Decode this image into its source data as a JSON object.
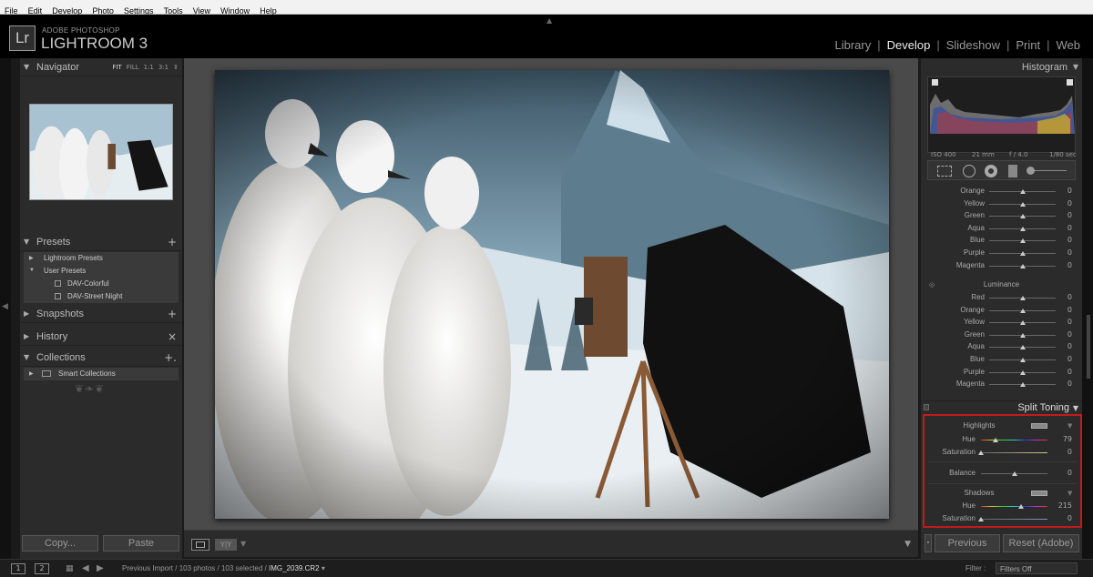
{
  "menubar": {
    "items": [
      "File",
      "Edit",
      "Develop",
      "Photo",
      "Settings",
      "Tools",
      "View",
      "Window",
      "Help"
    ]
  },
  "identity": {
    "top": "ADOBE PHOTOSHOP",
    "name": "LIGHTROOM 3",
    "logo": "Lr"
  },
  "modules": {
    "items": [
      {
        "label": "Library",
        "active": false
      },
      {
        "label": "Develop",
        "active": true
      },
      {
        "label": "Slideshow",
        "active": false
      },
      {
        "label": "Print",
        "active": false
      },
      {
        "label": "Web",
        "active": false
      }
    ]
  },
  "left_panel": {
    "navigator": {
      "title": "Navigator",
      "options": [
        "FIT",
        "FILL",
        "1:1",
        "3:1"
      ]
    },
    "presets": {
      "title": "Presets",
      "action": "+",
      "tree": [
        {
          "label": "Lightroom Presets",
          "level": 0,
          "open": false
        },
        {
          "label": "User Presets",
          "level": 0,
          "open": true
        },
        {
          "label": "DAV-Colorful",
          "level": 1
        },
        {
          "label": "DAV-Street Night",
          "level": 1
        }
      ]
    },
    "snapshots": {
      "title": "Snapshots",
      "action": "+"
    },
    "history": {
      "title": "History",
      "action": "×"
    },
    "collections": {
      "title": "Collections",
      "action": "+.",
      "smart": "Smart Collections"
    },
    "copy_label": "Copy...",
    "paste_label": "Paste"
  },
  "right_panel": {
    "histogram": {
      "title": "Histogram",
      "exif": [
        "ISO 400",
        "21 mm",
        "f / 4.0",
        "1/80 sec"
      ]
    },
    "hsl_top": [
      {
        "label": "Orange",
        "value": "0"
      },
      {
        "label": "Yellow",
        "value": "0"
      },
      {
        "label": "Green",
        "value": "0"
      },
      {
        "label": "Aqua",
        "value": "0"
      },
      {
        "label": "Blue",
        "value": "0"
      },
      {
        "label": "Purple",
        "value": "0"
      },
      {
        "label": "Magenta",
        "value": "0"
      }
    ],
    "luminance_title": "Luminance",
    "luminance": [
      {
        "label": "Red",
        "value": "0"
      },
      {
        "label": "Orange",
        "value": "0"
      },
      {
        "label": "Yellow",
        "value": "0"
      },
      {
        "label": "Green",
        "value": "0"
      },
      {
        "label": "Aqua",
        "value": "0"
      },
      {
        "label": "Blue",
        "value": "0"
      },
      {
        "label": "Purple",
        "value": "0"
      },
      {
        "label": "Magenta",
        "value": "0"
      }
    ],
    "split_toning": {
      "title": "Split Toning",
      "highlights_label": "Highlights",
      "highlights_hue_label": "Hue",
      "highlights_hue": "79",
      "highlights_hue_fraction": 0.22,
      "highlights_sat_label": "Saturation",
      "highlights_sat": "0",
      "highlights_sat_fraction": 0.0,
      "balance_label": "Balance",
      "balance": "0",
      "balance_fraction": 0.5,
      "shadows_label": "Shadows",
      "shadows_hue_label": "Hue",
      "shadows_hue": "215",
      "shadows_hue_fraction": 0.6,
      "shadows_sat_label": "Saturation",
      "shadows_sat": "0",
      "shadows_sat_fraction": 0.0,
      "highlight_box_color": "#c21a1a"
    },
    "previous_label": "Previous",
    "reset_label": "Reset (Adobe)"
  },
  "filmstrip": {
    "screen1": "1",
    "screen2": "2",
    "path_prefix": "Previous Import / 103 photos / 103 selected /",
    "current_file": "IMG_2039.CR2",
    "filter_label": "Filter :",
    "filter_value": "Filters Off"
  },
  "icons": {
    "grid": "grid-icon",
    "back": "back-arrow-icon",
    "forward": "forward-arrow-icon"
  }
}
